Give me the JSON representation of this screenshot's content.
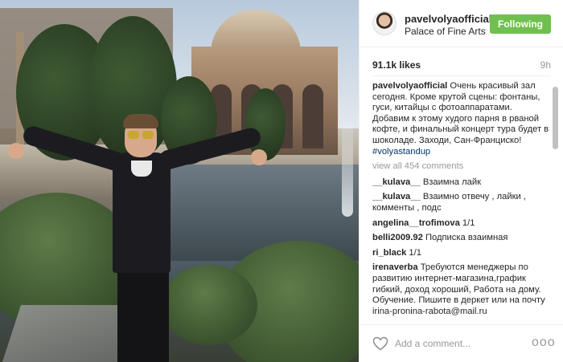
{
  "post": {
    "username": "pavelvolyaofficial",
    "location": "Palace of Fine Arts",
    "follow_label": "Following",
    "likes": "91.1k likes",
    "time": "9h"
  },
  "caption": {
    "username": "pavelvolyaofficial",
    "text": "Очень красивый зал сегодня. Кроме крутой сцены: фонтаны, гуси, китайцы с фотоаппаратами. Добавим к этому худого парня в рваной кофте, и финальный концерт тура будет в шоколаде. Заходи, Сан-Франциско!",
    "hashtag": "#volyastandup"
  },
  "view_all": "view all 454 comments",
  "comments": [
    {
      "user": "__kulava__",
      "text": "Взаимна лайк"
    },
    {
      "user": "__kulava__",
      "text": "Взаимно отвечу , лайки , комменты , подс"
    },
    {
      "user": "angelina__trofimova",
      "text": "1/1"
    },
    {
      "user": "belli2009.92",
      "text": "Подписка взаимная"
    },
    {
      "user": "ri_black",
      "text": "1/1"
    },
    {
      "user": "irenaverba",
      "text": "Требуются менеджеры по развитию интернет-магазина,график гибкий, доход хороший, Работа на дому. Обучение. Пишите в деркет или на почту irina-pronina-rabota@mail.ru"
    }
  ],
  "footer": {
    "comment_placeholder": "Add a comment...",
    "more_label": "ooo"
  },
  "icons": {
    "like": "heart-icon",
    "more": "more-options-icon"
  },
  "colors": {
    "follow_button": "#70c050",
    "hashtag": "#003569",
    "muted": "#999999"
  }
}
